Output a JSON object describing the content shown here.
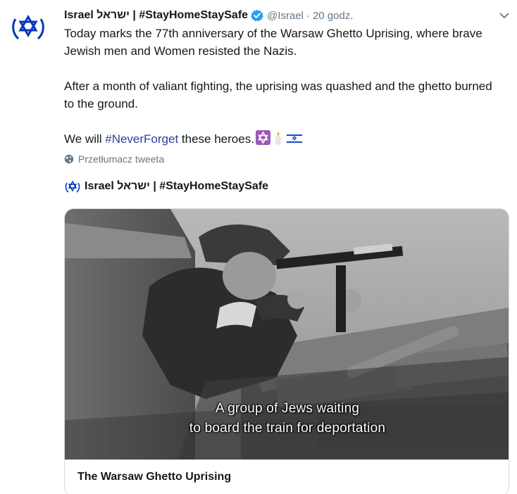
{
  "author": {
    "name": "Israel ישראל | #StayHomeStaySafe",
    "handle": "@Israel",
    "separator": "·",
    "time": "20 godz."
  },
  "tweet": {
    "paragraph1": "Today marks the 77th anniversary of the Warsaw Ghetto Uprising, where brave Jewish men and Women resisted the Nazis.",
    "paragraph2": "After a month of valiant fighting, the uprising was quashed and the ghetto burned to the ground.",
    "paragraph3_prefix": "We will ",
    "hashtag": "#NeverForget",
    "paragraph3_suffix": " these heroes."
  },
  "translate_label": "Przetłumacz tweeta",
  "quoted": {
    "author_name": "Israel ישראל | #StayHomeStaySafe"
  },
  "card": {
    "caption_line1": "A group of Jews waiting",
    "caption_line2": "to board the train for deportation",
    "title": "The Warsaw Ghetto Uprising"
  },
  "colors": {
    "accent": "#1da1f2",
    "hashtag": "#2b3f9e",
    "muted": "#657786",
    "israel_blue": "#0038b8"
  },
  "icons": [
    "star-of-david-avatar-icon",
    "verified-badge-icon",
    "chevron-down-icon",
    "globe-icon",
    "star-of-david-emoji-icon",
    "candle-emoji-icon",
    "israel-flag-emoji-icon"
  ]
}
